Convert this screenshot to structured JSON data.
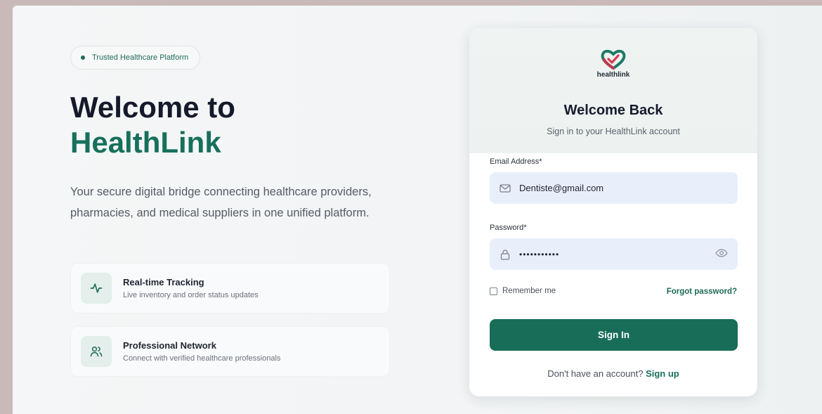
{
  "left": {
    "badge": "Trusted Healthcare Platform",
    "title_line1": "Welcome to",
    "title_line2": "HealthLink",
    "description": "Your secure digital bridge connecting healthcare providers, pharmacies, and medical suppliers in one unified platform.",
    "features": [
      {
        "icon": "activity-icon",
        "title": "Real-time Tracking",
        "subtitle": "Live inventory and order status updates"
      },
      {
        "icon": "users-icon",
        "title": "Professional Network",
        "subtitle": "Connect with verified healthcare professionals"
      }
    ]
  },
  "card": {
    "logo_text": "healthlink",
    "title": "Welcome Back",
    "subtitle": "Sign in to your HealthLink account",
    "email_label": "Email Address*",
    "email_value": "Dentiste@gmail.com",
    "password_label": "Password*",
    "password_value": "•••••••••••",
    "remember_label": "Remember me",
    "forgot_label": "Forgot password?",
    "signin_label": "Sign In",
    "signup_prompt": "Don't have an account?",
    "signup_link": "Sign up"
  },
  "colors": {
    "brand": "#17705c",
    "button": "#186d58",
    "heading": "#141a2b",
    "input_bg": "#e9eefb"
  }
}
